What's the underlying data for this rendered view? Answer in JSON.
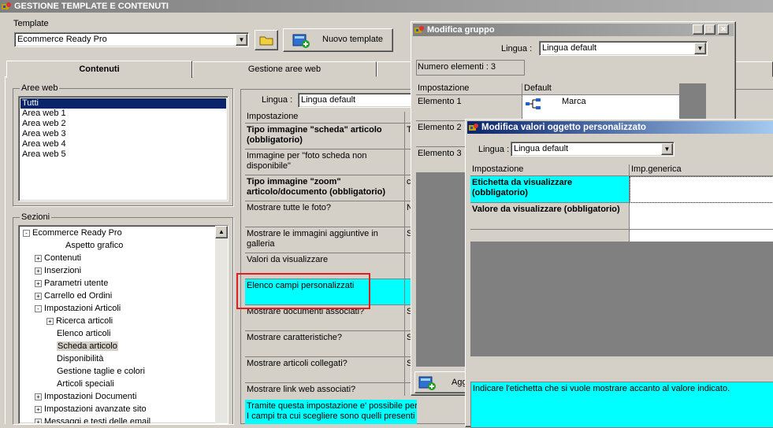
{
  "app": {
    "title": "GESTIONE TEMPLATE E CONTENUTI"
  },
  "template": {
    "label": "Template",
    "selected": "Ecommerce Ready Pro",
    "new_button": "Nuovo template"
  },
  "tabs": [
    "Contenuti",
    "Gestione aree web"
  ],
  "aree_web": {
    "label": "Aree web",
    "items": [
      "Tutti",
      "Area web 1",
      "Area web 2",
      "Area web 3",
      "Area web 4",
      "Area web 5"
    ]
  },
  "sezioni": {
    "label": "Sezioni",
    "items": [
      {
        "text": "Ecommerce Ready Pro",
        "exp": "-"
      },
      {
        "text": "Aspetto grafico",
        "exp": ""
      },
      {
        "text": "Contenuti",
        "exp": "+"
      },
      {
        "text": "Inserzioni",
        "exp": "+"
      },
      {
        "text": "Parametri utente",
        "exp": "+"
      },
      {
        "text": "Carrello ed Ordini",
        "exp": "+"
      },
      {
        "text": "Impostazioni Articoli",
        "exp": "-"
      },
      {
        "text": "Ricerca articoli",
        "exp": "+"
      },
      {
        "text": "Elenco articoli",
        "exp": ""
      },
      {
        "text": "Scheda articolo",
        "exp": ""
      },
      {
        "text": "Disponibilità",
        "exp": ""
      },
      {
        "text": "Gestione taglie e colori",
        "exp": ""
      },
      {
        "text": "Articoli speciali",
        "exp": ""
      },
      {
        "text": "Impostazioni Documenti",
        "exp": "+"
      },
      {
        "text": "Impostazioni avanzate sito",
        "exp": "+"
      },
      {
        "text": "Messaggi e testi delle email",
        "exp": "+"
      }
    ]
  },
  "main": {
    "lingua_label": "Lingua :",
    "lingua_value": "Lingua default",
    "col_impostazione": "Impostazione",
    "rows": [
      "Tipo immagine \"scheda\" articolo (obbligatorio)",
      "Immagine per \"foto scheda non disponibile\"",
      "Tipo immagine \"zoom\" articolo/documento (obbligatorio)",
      "Mostrare tutte le foto?",
      "Mostrare le immagini aggiuntive in galleria",
      "Valori da visualizzare",
      "Elenco campi personalizzati",
      "Mostrare documenti associati?",
      "Mostrare caratteristiche?",
      "Mostrare articoli collegati?",
      "Mostrare link web associati?"
    ],
    "value_fragments": [
      "T",
      "",
      "c",
      "N",
      "S",
      "",
      "",
      "S",
      "S",
      "S",
      ""
    ],
    "description": "Tramite questa impostazione e' possibile personalizzare i",
    "description2": "I campi tra cui scegliere sono quelli presenti nell'anagrafic"
  },
  "gruppo": {
    "title": "Modifica gruppo",
    "lingua_label": "Lingua :",
    "lingua_value": "Lingua default",
    "numero": "Numero elementi : 3",
    "col_impostazione": "Impostazione",
    "col_default": "Default",
    "elements": [
      "Elemento 1",
      "Elemento 2",
      "Elemento 3"
    ],
    "elemento1_value": "Marca",
    "add_fragment": "Agg"
  },
  "valori": {
    "title": "Modifica valori oggetto personalizzato",
    "lingua_label": "Lingua :",
    "lingua_value": "Lingua default",
    "col_impostazione": "Impostazione",
    "col_generica": "Imp.generica",
    "rows": [
      "Etichetta da visualizzare (obbligatorio)",
      "Valore da visualizzare (obbligatorio)"
    ],
    "hint": "Indicare l'etichetta che si vuole mostrare accanto al valore indicato."
  },
  "colors": {
    "highlight": "#00ffff",
    "selection": "#0a246a",
    "annotation": "#e02020"
  }
}
